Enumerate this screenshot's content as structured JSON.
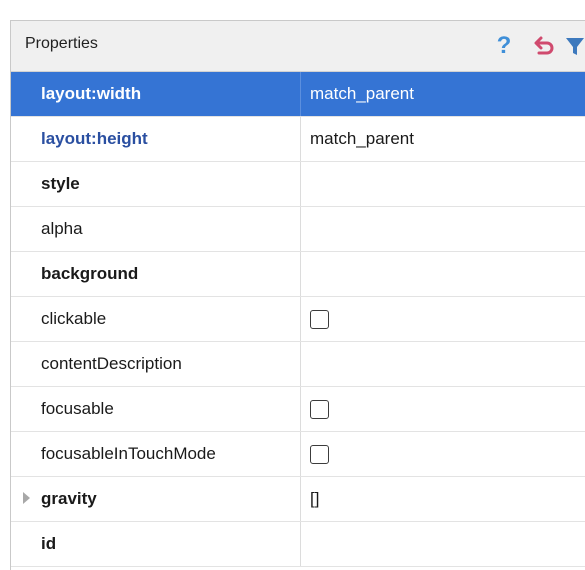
{
  "panel": {
    "title": "Properties",
    "tools": {
      "help_glyph": "?"
    },
    "accent_color": "#3574d4"
  },
  "rows": [
    {
      "name": "layout:width",
      "value": "match_parent"
    },
    {
      "name": "layout:height",
      "value": "match_parent"
    },
    {
      "name": "style",
      "value": ""
    },
    {
      "name": "alpha",
      "value": ""
    },
    {
      "name": "background",
      "value": ""
    },
    {
      "name": "clickable",
      "value": "",
      "checkbox": "unchecked"
    },
    {
      "name": "contentDescription",
      "value": ""
    },
    {
      "name": "focusable",
      "value": "",
      "checkbox": "unchecked"
    },
    {
      "name": "focusableInTouchMode",
      "value": "",
      "checkbox": "unchecked"
    },
    {
      "name": "gravity",
      "value": "[]"
    },
    {
      "name": "id",
      "value": ""
    }
  ]
}
